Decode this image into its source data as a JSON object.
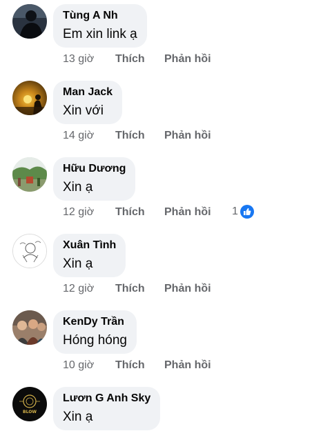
{
  "comments": [
    {
      "author": "Tùng A Nh",
      "text": "Em xin link ạ",
      "time": "13 giờ",
      "like_label": "Thích",
      "reply_label": "Phản hồi",
      "avatar": "dark-silhouette"
    },
    {
      "author": "Man Jack",
      "text": "Xin với",
      "time": "14 giờ",
      "like_label": "Thích",
      "reply_label": "Phản hồi",
      "avatar": "sunset-silhouette"
    },
    {
      "author": "Hữu Dương",
      "text": "Xin ạ",
      "time": "12 giờ",
      "like_label": "Thích",
      "reply_label": "Phản hồi",
      "reaction_count": "1",
      "reaction_icon": "thumbs-up-icon",
      "avatar": "garden-scene"
    },
    {
      "author": "Xuân Tình",
      "text": "Xin ạ",
      "time": "12 giờ",
      "like_label": "Thích",
      "reply_label": "Phản hồi",
      "avatar": "line-drawing"
    },
    {
      "author": "KenDy Trần",
      "text": "Hóng hóng",
      "time": "10 giờ",
      "like_label": "Thích",
      "reply_label": "Phản hồi",
      "avatar": "group-photo"
    },
    {
      "author": "Lươn G Anh Sky",
      "text": "Xin ạ",
      "avatar": "black-logo",
      "logo_text": "BLOW"
    }
  ],
  "colors": {
    "bubble": "#f0f2f5",
    "text": "#050505",
    "meta": "#65676b",
    "like_blue": "#1877f2"
  }
}
